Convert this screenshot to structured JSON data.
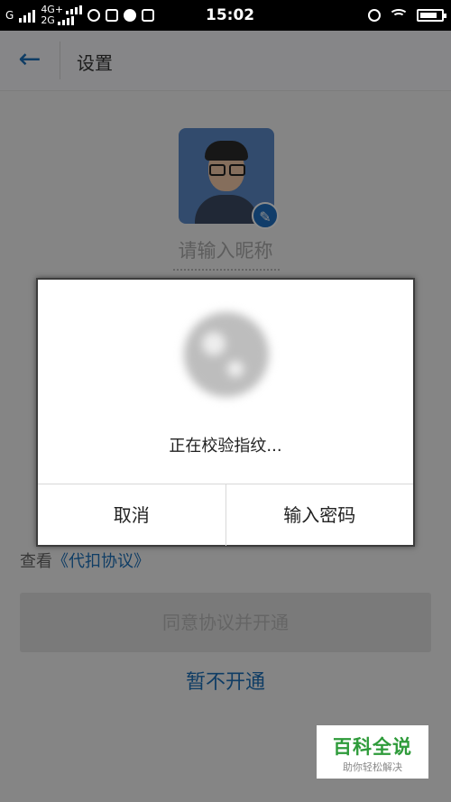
{
  "status_bar": {
    "carrier_left": "G",
    "network_top": "4G+",
    "network_bottom": "2G",
    "time": "15:02",
    "battery_level": 0.8
  },
  "app_bar": {
    "title": "设置"
  },
  "profile": {
    "nickname_placeholder": "请输入昵称"
  },
  "agreement": {
    "prefix": "查看",
    "link": "《代扣协议》"
  },
  "buttons": {
    "agree_open": "同意协议并开通",
    "not_now": "暂不开通"
  },
  "dialog": {
    "message": "正在校验指纹...",
    "cancel_label": "取消",
    "password_label": "输入密码"
  },
  "watermark": {
    "title": "百科全说",
    "subtitle": "助你轻松解决"
  }
}
